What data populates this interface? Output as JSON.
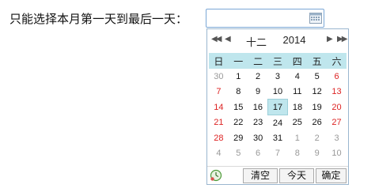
{
  "prompt": {
    "label": "只能选择本月第一天到最后一天："
  },
  "date_input": {
    "value": "",
    "calendar_icon": "calendar-icon"
  },
  "picker": {
    "nav": {
      "prev_year": "◀◀",
      "prev_month": "◀",
      "next_month": "▶",
      "next_year": "▶▶"
    },
    "month": "十二",
    "year": "2014",
    "weekdays": [
      "日",
      "一",
      "二",
      "三",
      "四",
      "五",
      "六"
    ],
    "weeks": [
      [
        "30",
        "1",
        "2",
        "3",
        "4",
        "5",
        "6"
      ],
      [
        "7",
        "8",
        "9",
        "10",
        "11",
        "12",
        "13"
      ],
      [
        "14",
        "15",
        "16",
        "17",
        "18",
        "19",
        "20"
      ],
      [
        "21",
        "22",
        "23",
        "24",
        "25",
        "26",
        "27"
      ],
      [
        "28",
        "29",
        "30",
        "31",
        "1",
        "2",
        "3"
      ],
      [
        "4",
        "5",
        "6",
        "7",
        "8",
        "9",
        "10"
      ]
    ],
    "selected_day": "17",
    "footer": {
      "time_icon": "clock-icon",
      "clear": "清空",
      "today": "今天",
      "ok": "确定"
    },
    "colors": {
      "header_bg": "#bfe6ed",
      "weekend": "#d22222",
      "other_month": "#999999"
    }
  }
}
